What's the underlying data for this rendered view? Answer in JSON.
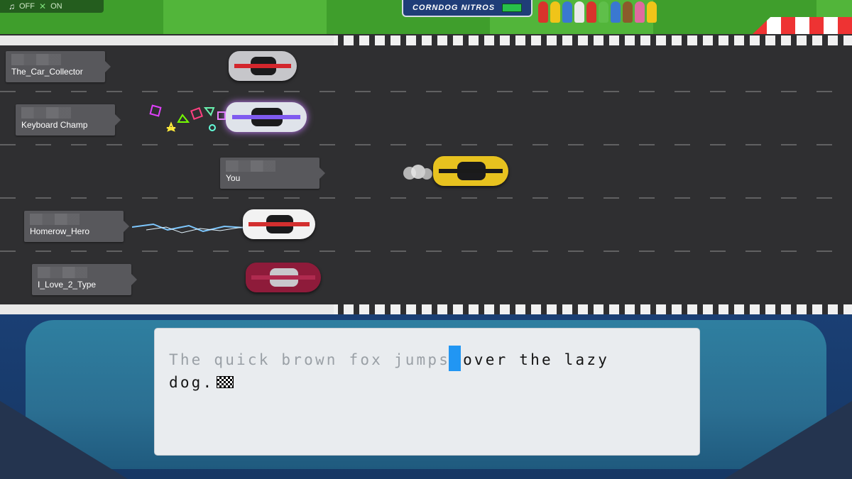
{
  "sound_toggle": {
    "icon": "music-note-icon",
    "state": "OFF"
  },
  "mute_toggle": {
    "icon": "x-icon",
    "state": "ON"
  },
  "sponsor_banner": {
    "text": "CORNDOG NITROS"
  },
  "racers": [
    {
      "name": "The_Car_Collector",
      "car_color": "#c0c0c4",
      "trail": "none"
    },
    {
      "name": "Keyboard Champ",
      "car_color": "#e2e6ee",
      "trail": "confetti"
    },
    {
      "name": "You",
      "car_color": "#e7c21f",
      "trail": "smoke"
    },
    {
      "name": "Homerow_Hero",
      "car_color": "#f2f2f2",
      "trail": "lightning"
    },
    {
      "name": "I_Love_2_Type",
      "car_color": "#8e1b3a",
      "trail": "none"
    }
  ],
  "race_progress": [
    0.29,
    0.31,
    0.54,
    0.32,
    0.33
  ],
  "typing": {
    "typed_text": "The quick brown fox jumps",
    "cursor_char": " ",
    "remaining_line1": "over the lazy",
    "remaining_line2": "dog."
  },
  "colors": {
    "cursor": "#2196f3",
    "track": "#2f2f31",
    "grass": "#52b53a"
  }
}
